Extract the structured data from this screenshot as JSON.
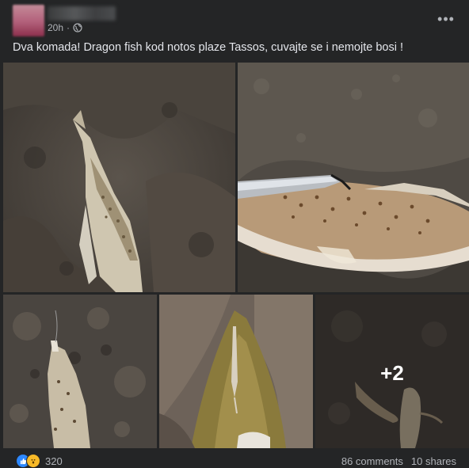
{
  "post": {
    "timestamp": "20h",
    "separator": "·",
    "privacy_icon": "globe-icon",
    "more_icon": "more-horizontal-icon",
    "more_label": "•••",
    "caption": "Dva komada! Dragon fish kod notos plaze Tassos, cuvajte se i nemojte bosi !"
  },
  "photos": {
    "remaining_count": "+2"
  },
  "footer": {
    "reaction_icons": [
      "like-icon",
      "wow-icon"
    ],
    "reaction_count": "320",
    "comments": "86 comments",
    "shares": "10 shares"
  },
  "colors": {
    "background": "#242526",
    "text_primary": "#e4e6eb",
    "text_secondary": "#b0b3b8",
    "like_blue": "#2d88ff",
    "wow_yellow": "#f7b928"
  }
}
